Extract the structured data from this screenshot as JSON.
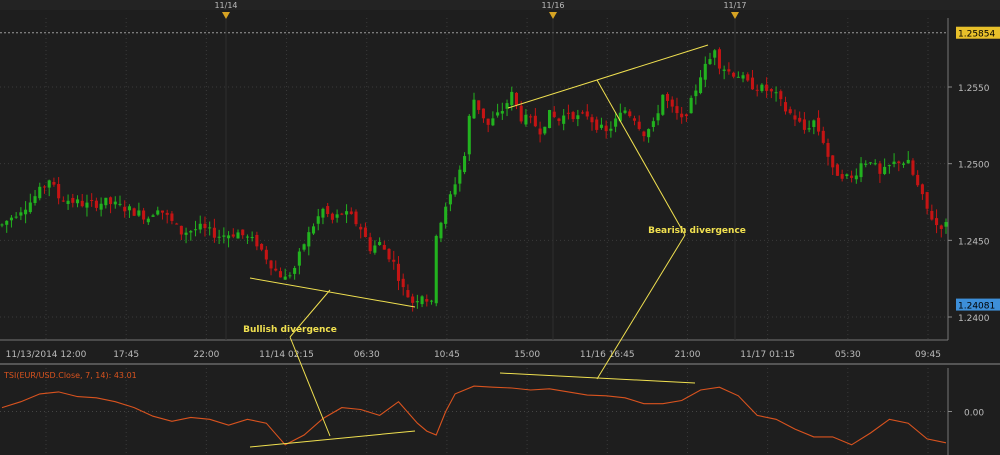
{
  "chart_data": [
    {
      "type": "candlestick",
      "symbol": "EUR/USD",
      "colors": {
        "up": "#22b21f",
        "down": "#c41414",
        "background": "#1e1e1e",
        "grid": "#3a3a3a",
        "text": "#bbbbbb",
        "last_price_bg": "#e8c02a",
        "cursor_price_bg": "#3d8fd9",
        "annotation": "#f0e050"
      },
      "grid": true,
      "ylim": [
        1.2385,
        1.2595
      ],
      "y_ticks": [
        1.24,
        1.245,
        1.25,
        1.255
      ],
      "y_tick_labels": [
        "1.2400",
        "1.2450",
        "1.2500",
        "1.2550"
      ],
      "last_price_label": "1.25854",
      "last_price_value": 1.25854,
      "cursor_price_label": "1.24081",
      "cursor_price_value": 1.24081,
      "x_tick_labels": [
        "11/13/2014 12:00",
        "17:45",
        "22:00",
        "11/14 02:15",
        "06:30",
        "10:45",
        "15:00",
        "11/16 16:45",
        "21:00",
        "11/17 01:15",
        "05:30",
        "09:45"
      ],
      "date_markers": [
        "11/14",
        "11/16",
        "11/17"
      ],
      "ohlc_path": [
        [
          0,
          1.246
        ],
        [
          3,
          1.2468
        ],
        [
          6,
          1.2475
        ],
        [
          8,
          1.2482
        ],
        [
          10,
          1.249
        ],
        [
          12,
          1.2478
        ],
        [
          18,
          1.2473
        ],
        [
          22,
          1.2475
        ],
        [
          27,
          1.247
        ],
        [
          31,
          1.2465
        ],
        [
          33,
          1.2472
        ],
        [
          38,
          1.2455
        ],
        [
          42,
          1.2458
        ],
        [
          46,
          1.2453
        ],
        [
          50,
          1.2455
        ],
        [
          54,
          1.2448
        ],
        [
          58,
          1.243
        ],
        [
          60,
          1.2425
        ],
        [
          62,
          1.2432
        ],
        [
          64,
          1.2448
        ],
        [
          66,
          1.246
        ],
        [
          68,
          1.247
        ],
        [
          70,
          1.2463
        ],
        [
          72,
          1.2468
        ],
        [
          74,
          1.2465
        ],
        [
          76,
          1.2458
        ],
        [
          78,
          1.2445
        ],
        [
          80,
          1.2448
        ],
        [
          82,
          1.244
        ],
        [
          83,
          1.2435
        ],
        [
          85,
          1.2418
        ],
        [
          87,
          1.241
        ],
        [
          89,
          1.2415
        ],
        [
          91,
          1.2408
        ],
        [
          92,
          1.2455
        ],
        [
          94,
          1.247
        ],
        [
          96,
          1.2488
        ],
        [
          98,
          1.2505
        ],
        [
          99,
          1.253
        ],
        [
          100,
          1.2542
        ],
        [
          103,
          1.2525
        ],
        [
          106,
          1.2535
        ],
        [
          108,
          1.2545
        ],
        [
          110,
          1.253
        ],
        [
          112,
          1.2528
        ],
        [
          114,
          1.2522
        ],
        [
          116,
          1.2532
        ],
        [
          118,
          1.2528
        ],
        [
          120,
          1.2534
        ],
        [
          122,
          1.253
        ],
        [
          124,
          1.2532
        ],
        [
          126,
          1.2525
        ],
        [
          128,
          1.252
        ],
        [
          130,
          1.2528
        ],
        [
          132,
          1.2535
        ],
        [
          134,
          1.253
        ],
        [
          136,
          1.252
        ],
        [
          138,
          1.2525
        ],
        [
          140,
          1.2545
        ],
        [
          142,
          1.2535
        ],
        [
          144,
          1.2528
        ],
        [
          146,
          1.254
        ],
        [
          148,
          1.2558
        ],
        [
          150,
          1.2568
        ],
        [
          151,
          1.2576
        ],
        [
          152,
          1.2565
        ],
        [
          154,
          1.256
        ],
        [
          156,
          1.2558
        ],
        [
          158,
          1.2552
        ],
        [
          160,
          1.255
        ],
        [
          162,
          1.2548
        ],
        [
          164,
          1.2544
        ],
        [
          166,
          1.2535
        ],
        [
          168,
          1.253
        ],
        [
          170,
          1.2522
        ],
        [
          172,
          1.2528
        ],
        [
          174,
          1.2515
        ],
        [
          176,
          1.2495
        ],
        [
          178,
          1.2493
        ],
        [
          180,
          1.249
        ],
        [
          182,
          1.25
        ],
        [
          184,
          1.2503
        ],
        [
          186,
          1.2492
        ],
        [
          188,
          1.2498
        ],
        [
          190,
          1.2502
        ],
        [
          192,
          1.25
        ],
        [
          194,
          1.2485
        ],
        [
          196,
          1.247
        ],
        [
          198,
          1.246
        ],
        [
          200,
          1.246
        ]
      ],
      "annotations": [
        {
          "label": "Bullish divergence"
        },
        {
          "label": "Bearish divergence"
        }
      ]
    },
    {
      "type": "line",
      "indicator_label": "TSI(EUR/USD.Close, 7, 14): 43.01",
      "y_tick_labels": [
        "0.00"
      ],
      "ylim": [
        -100,
        100
      ],
      "color": "#d9531e",
      "x": [
        0,
        4,
        8,
        12,
        16,
        20,
        24,
        28,
        32,
        36,
        40,
        44,
        48,
        52,
        56,
        60,
        64,
        68,
        72,
        76,
        80,
        84,
        88,
        90,
        92,
        94,
        96,
        100,
        104,
        108,
        112,
        116,
        120,
        124,
        128,
        132,
        136,
        140,
        144,
        148,
        152,
        156,
        160,
        164,
        168,
        172,
        176,
        180,
        184,
        188,
        192,
        196,
        200
      ],
      "y": [
        10,
        25,
        45,
        50,
        38,
        35,
        25,
        10,
        -12,
        -25,
        -15,
        -20,
        -35,
        -20,
        -30,
        -85,
        -60,
        -18,
        10,
        5,
        -10,
        25,
        -30,
        -50,
        -60,
        0,
        45,
        65,
        62,
        60,
        55,
        58,
        50,
        42,
        40,
        35,
        20,
        20,
        28,
        55,
        62,
        40,
        -10,
        -20,
        -45,
        -65,
        -65,
        -85,
        -55,
        -20,
        -30,
        -70,
        -80
      ]
    }
  ]
}
